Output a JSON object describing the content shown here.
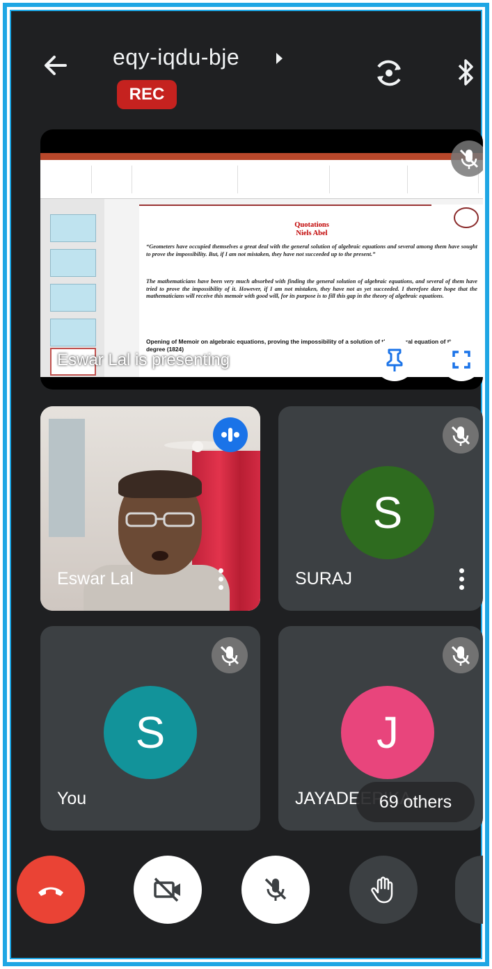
{
  "header": {
    "meeting_code": "eqy-iqdu-bje",
    "rec_label": "REC"
  },
  "presentation": {
    "presenting_label": "Eswar Lal is presenting",
    "slide": {
      "title_line1": "Quotations",
      "title_line2": "Niels Abel",
      "quote1": "“Geometers have occupied themselves a great deal with the general solution of algebraic equations and several among them have sought to prove the impossibility. But, if I am not mistaken, they have not succeeded up to the present.”",
      "quote2": "The mathematicians have been very much absorbed with finding the general solution of algebraic equations, and several of them have tried to prove the impossibility of it. However, if I am not mistaken, they have not as yet succeeded. I therefore dare hope that the mathematicians will receive this memoir with good will, for its purpose is to fill this gap in the theory of algebraic equations.",
      "footer": "Opening of Memoir on algebraic equations, proving the impossibility of a solution of the general equation of the fifth degree (1824)"
    }
  },
  "participants": [
    {
      "name": "Eswar Lal",
      "type": "video",
      "speaking": true
    },
    {
      "name": "SURAJ",
      "initial": "S",
      "color": "#2e6b1f",
      "muted": true
    },
    {
      "name": "You",
      "initial": "S",
      "color": "#12939a",
      "muted": true
    },
    {
      "name": "JAYADEEPIKA",
      "initial": "J",
      "color": "#e8457c",
      "muted": true
    }
  ],
  "others_label": "69 others",
  "colors": {
    "background": "#1f2022",
    "tile": "#3c4043",
    "end_call": "#ea4335",
    "rec": "#c5221f",
    "frame": "#1ea6e4"
  },
  "icons": [
    "back-arrow-icon",
    "caret-right-icon",
    "switch-camera-icon",
    "bluetooth-icon",
    "mic-off-icon",
    "pin-icon",
    "fullscreen-icon",
    "more-vert-icon",
    "audio-wave-icon",
    "end-call-icon",
    "camera-off-icon",
    "raise-hand-icon"
  ]
}
